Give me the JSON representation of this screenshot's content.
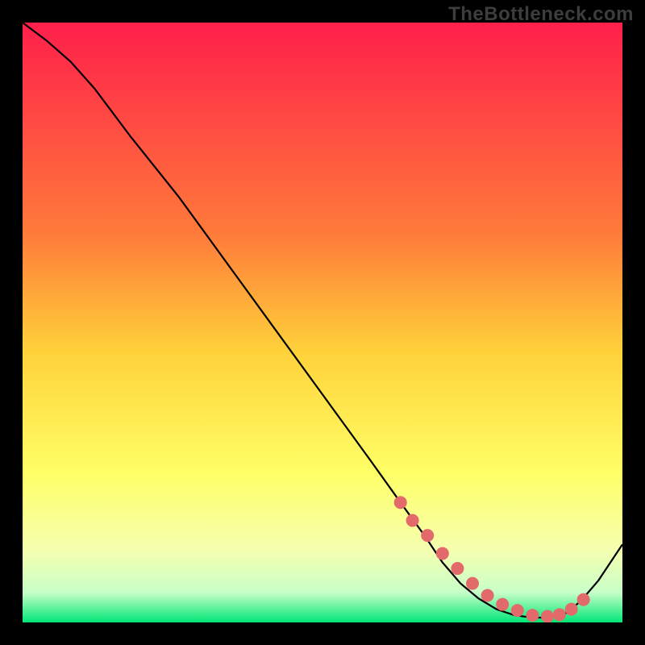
{
  "watermark": "TheBottleneck.com",
  "chart_data": {
    "type": "line",
    "title": "",
    "xlabel": "",
    "ylabel": "",
    "xlim": [
      0,
      100
    ],
    "ylim": [
      0,
      100
    ],
    "grid": false,
    "legend": false,
    "background_gradient": {
      "stops": [
        {
          "offset": 0,
          "color": "#ff1f4b"
        },
        {
          "offset": 35,
          "color": "#ff7a3a"
        },
        {
          "offset": 55,
          "color": "#ffd23a"
        },
        {
          "offset": 75,
          "color": "#ffff66"
        },
        {
          "offset": 88,
          "color": "#f5ffb0"
        },
        {
          "offset": 95,
          "color": "#c8ffc8"
        },
        {
          "offset": 100,
          "color": "#00e676"
        }
      ]
    },
    "series": [
      {
        "name": "curve",
        "color": "#000000",
        "x": [
          0,
          4,
          8,
          12,
          18,
          26,
          34,
          42,
          50,
          58,
          63,
          67,
          70,
          73,
          76,
          79,
          82,
          85,
          88,
          90.5,
          93,
          96,
          100
        ],
        "y": [
          100,
          97,
          93.5,
          89,
          81,
          71,
          60,
          49,
          38,
          27,
          20,
          14.5,
          10,
          6.5,
          4,
          2.2,
          1.2,
          0.8,
          0.8,
          1.5,
          3.5,
          7,
          13
        ]
      }
    ],
    "markers": {
      "name": "highlight-dots",
      "color": "#e26a6a",
      "radius": 8,
      "x": [
        63,
        65,
        67.5,
        70,
        72.5,
        75,
        77.5,
        80,
        82.5,
        85,
        87.5,
        89.5,
        91.5,
        93.5
      ],
      "y": [
        20,
        17,
        14.5,
        11.5,
        9,
        6.5,
        4.5,
        3,
        2,
        1.2,
        1,
        1.3,
        2.2,
        3.8
      ]
    }
  }
}
